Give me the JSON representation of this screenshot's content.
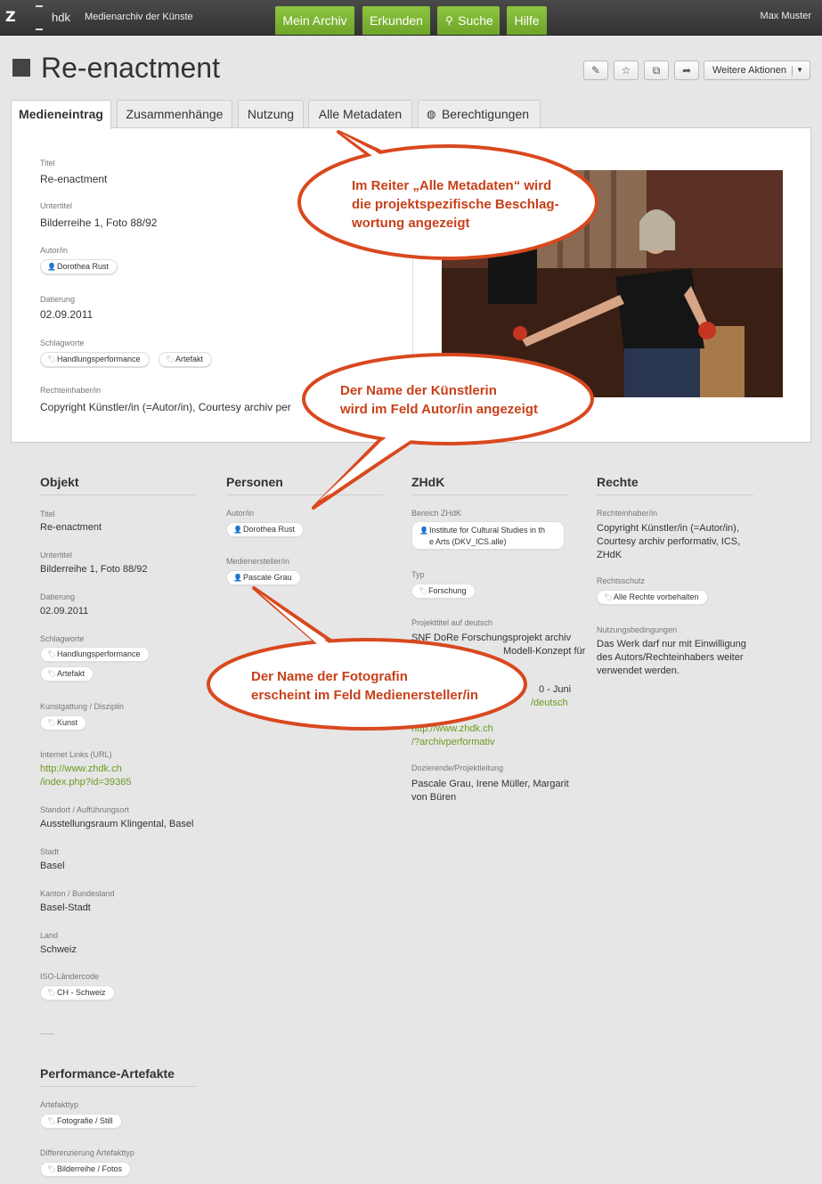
{
  "topbar": {
    "logo": "Z",
    "hdk": "hdk",
    "archive_name": "Medienarchiv der Künste",
    "nav": [
      "Mein Archiv",
      "Erkunden",
      "Suche",
      "Hilfe"
    ],
    "user": "Max Muster"
  },
  "header": {
    "title": "Re-enactment",
    "more_actions": "Weitere Aktionen"
  },
  "tabs": [
    "Medieneintrag",
    "Zusammenhänge",
    "Nutzung",
    "Alle Metadaten",
    "Berechtigungen"
  ],
  "summary": {
    "titel_label": "Titel",
    "titel": "Re-enactment",
    "untertitel_label": "Untertitel",
    "untertitel": "Bilderreihe 1, Foto 88/92",
    "autor_label": "Autor/in",
    "autor": "Dorothea Rust",
    "datierung_label": "Datierung",
    "datierung": "02.09.2011",
    "schlagworte_label": "Schlagworte",
    "schlagworte": [
      "Handlungsperformance",
      "Artefakt"
    ],
    "rechte_label": "Rechteinhaber/in",
    "rechte": "Copyright Künstler/in (=Autor/in), Courtesy archiv per"
  },
  "objekt": {
    "heading": "Objekt",
    "titel_label": "Titel",
    "titel": "Re-enactment",
    "untertitel_label": "Untertitel",
    "untertitel": "Bilderreihe 1, Foto 88/92",
    "datierung_label": "Datierung",
    "datierung": "02.09.2011",
    "schlagworte_label": "Schlagworte",
    "schlagworte": [
      "Handlungsperformance",
      "Artefakt"
    ],
    "kunstgattung_label": "Kunstgattung / Disziplin",
    "kunstgattung": "Kunst",
    "links_label": "Internet Links (URL)",
    "link_1": "http://www.zhdk.ch",
    "link_2": "/index.php?id=39365",
    "standort_label": "Standort / Aufführungsort",
    "standort": "Ausstellungsraum Klingental, Basel",
    "stadt_label": "Stadt",
    "stadt": "Basel",
    "kanton_label": "Kanton / Bundesland",
    "kanton": "Basel-Stadt",
    "land_label": "Land",
    "land": "Schweiz",
    "iso_label": "ISO-Ländercode",
    "iso": "CH - Schweiz"
  },
  "personen": {
    "heading": "Personen",
    "autor_label": "Autor/in",
    "autor": "Dorothea Rust",
    "medienersteller_label": "Medienersteller/in",
    "medienersteller": "Pascale Grau"
  },
  "zhdk": {
    "heading": "ZHdK",
    "bereich_label": "Bereich ZHdK",
    "bereich_1": "Institute for Cultural Studies in th",
    "bereich_2": "e Arts (DKV_ICS.alle)",
    "typ_label": "Typ",
    "typ": "Forschung",
    "projekttitel_label": "Projekttitel auf deutsch",
    "projekttitel_1": "SNF DoRe Forschungsprojekt archiv",
    "projekttitel_2": "Modell-Konzept für",
    "projekttitel_3": "0 - Juni",
    "projekttitel_4": "/deutsch",
    "link_1": "http://www.zhdk.ch",
    "link_2": "/?archivperformativ",
    "dozierende_label": "Dozierende/Projektleitung",
    "dozierende_1": "Pascale Grau, Irene Müller, Margarit",
    "dozierende_2": "von Büren"
  },
  "rechte": {
    "heading": "Rechte",
    "inhaber_label": "Rechteinhaber/in",
    "inhaber_1": "Copyright Künstler/in (=Autor/in),",
    "inhaber_2": "Courtesy archiv performativ, ICS,",
    "inhaber_3": "ZHdK",
    "schutz_label": "Rechtsschutz",
    "schutz": "Alle Rechte vorbehalten",
    "nutzung_label": "Nutzungsbedingungen",
    "nutzung_1": "Das Werk darf nur mit Einwilligung",
    "nutzung_2": "des Autors/Rechteinhabers weiter",
    "nutzung_3": "verwendet werden."
  },
  "performance": {
    "heading": "Performance-Artefakte",
    "artefakttyp_label": "Artefakttyp",
    "artefakttyp": "Fotografie / Still",
    "differenzierung_label": "Differenzierung Artefakttyp",
    "differenzierung": "Bilderreihe / Fotos"
  },
  "callouts": {
    "c1_line1": "Im Reiter „Alle Metadaten“ wird",
    "c1_line2": "die projektspezifische Beschlag-",
    "c1_line3": "wortung angezeigt",
    "c2_line1": "Der Name der Künstlerin",
    "c2_line2": "wird im Feld Autor/in angezeigt",
    "c3_line1": "Der Name der Fotografin",
    "c3_line2": "erscheint im Feld Medienersteller/in"
  },
  "colors": {
    "nav_green": "#7cb836",
    "callout": "#d9481f",
    "link": "#6a9a1f"
  }
}
